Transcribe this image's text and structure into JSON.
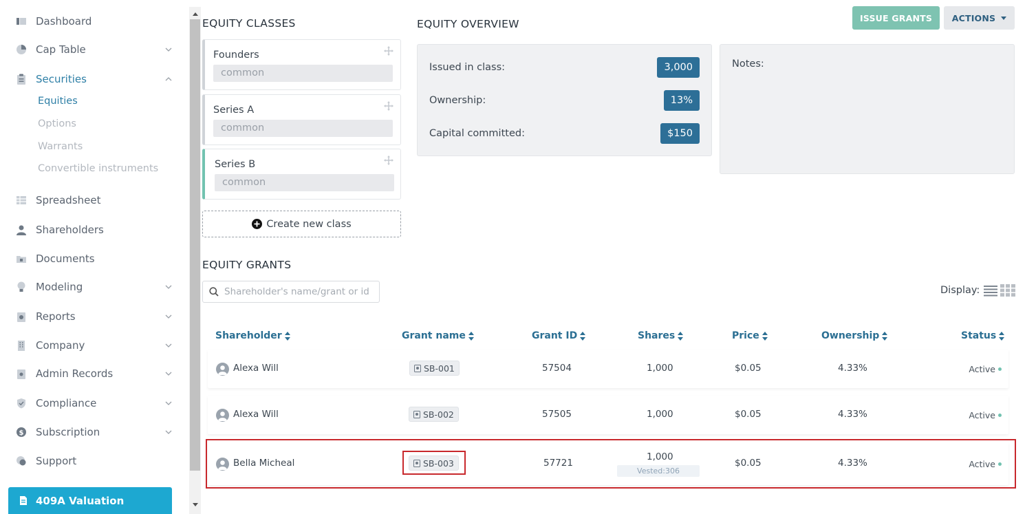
{
  "sidebar": {
    "items": [
      {
        "label": "Dashboard"
      },
      {
        "label": "Cap Table"
      },
      {
        "label": "Securities"
      },
      {
        "label": "Spreadsheet"
      },
      {
        "label": "Shareholders"
      },
      {
        "label": "Documents"
      },
      {
        "label": "Modeling"
      },
      {
        "label": "Reports"
      },
      {
        "label": "Company"
      },
      {
        "label": "Admin Records"
      },
      {
        "label": "Compliance"
      },
      {
        "label": "Subscription"
      },
      {
        "label": "Support"
      }
    ],
    "securities_sub": [
      "Equities",
      "Options",
      "Warrants",
      "Convertible instruments"
    ],
    "valuation_label": "409A Valuation"
  },
  "equity_classes": {
    "title": "EQUITY CLASSES",
    "classes": [
      {
        "name": "Founders",
        "type": "common"
      },
      {
        "name": "Series A",
        "type": "common"
      },
      {
        "name": "Series B",
        "type": "common"
      }
    ],
    "create_label": "Create new class"
  },
  "overview": {
    "title": "EQUITY OVERVIEW",
    "rows": [
      {
        "label": "Issued in class:",
        "value": "3,000"
      },
      {
        "label": "Ownership:",
        "value": "13%"
      },
      {
        "label": "Capital committed:",
        "value": "$150"
      }
    ],
    "notes_label": "Notes:"
  },
  "toolbar": {
    "issue_label": "ISSUE GRANTS",
    "actions_label": "ACTIONS"
  },
  "grants": {
    "title": "EQUITY GRANTS",
    "search_placeholder": "Shareholder's name/grant or id",
    "display_label": "Display:",
    "columns": [
      "Shareholder",
      "Grant name",
      "Grant ID",
      "Shares",
      "Price",
      "Ownership",
      "Status"
    ],
    "rows": [
      {
        "shareholder": "Alexa Will",
        "grant_name": "SB-001",
        "grant_id": "57504",
        "shares": "1,000",
        "price": "$0.05",
        "ownership": "4.33%",
        "status": "Active",
        "vested": ""
      },
      {
        "shareholder": "Alexa Will",
        "grant_name": "SB-002",
        "grant_id": "57505",
        "shares": "1,000",
        "price": "$0.05",
        "ownership": "4.33%",
        "status": "Active",
        "vested": ""
      },
      {
        "shareholder": "Bella Micheal",
        "grant_name": "SB-003",
        "grant_id": "57721",
        "shares": "1,000",
        "price": "$0.05",
        "ownership": "4.33%",
        "status": "Active",
        "vested": "Vested:306"
      }
    ]
  },
  "colors": {
    "accent": "#2e7fa6",
    "badge": "#2d6f97",
    "issue_button": "#7ec3b1",
    "valuation_button": "#1da8d1",
    "highlight": "#c8282c",
    "status_dot": "#72c2b0"
  }
}
